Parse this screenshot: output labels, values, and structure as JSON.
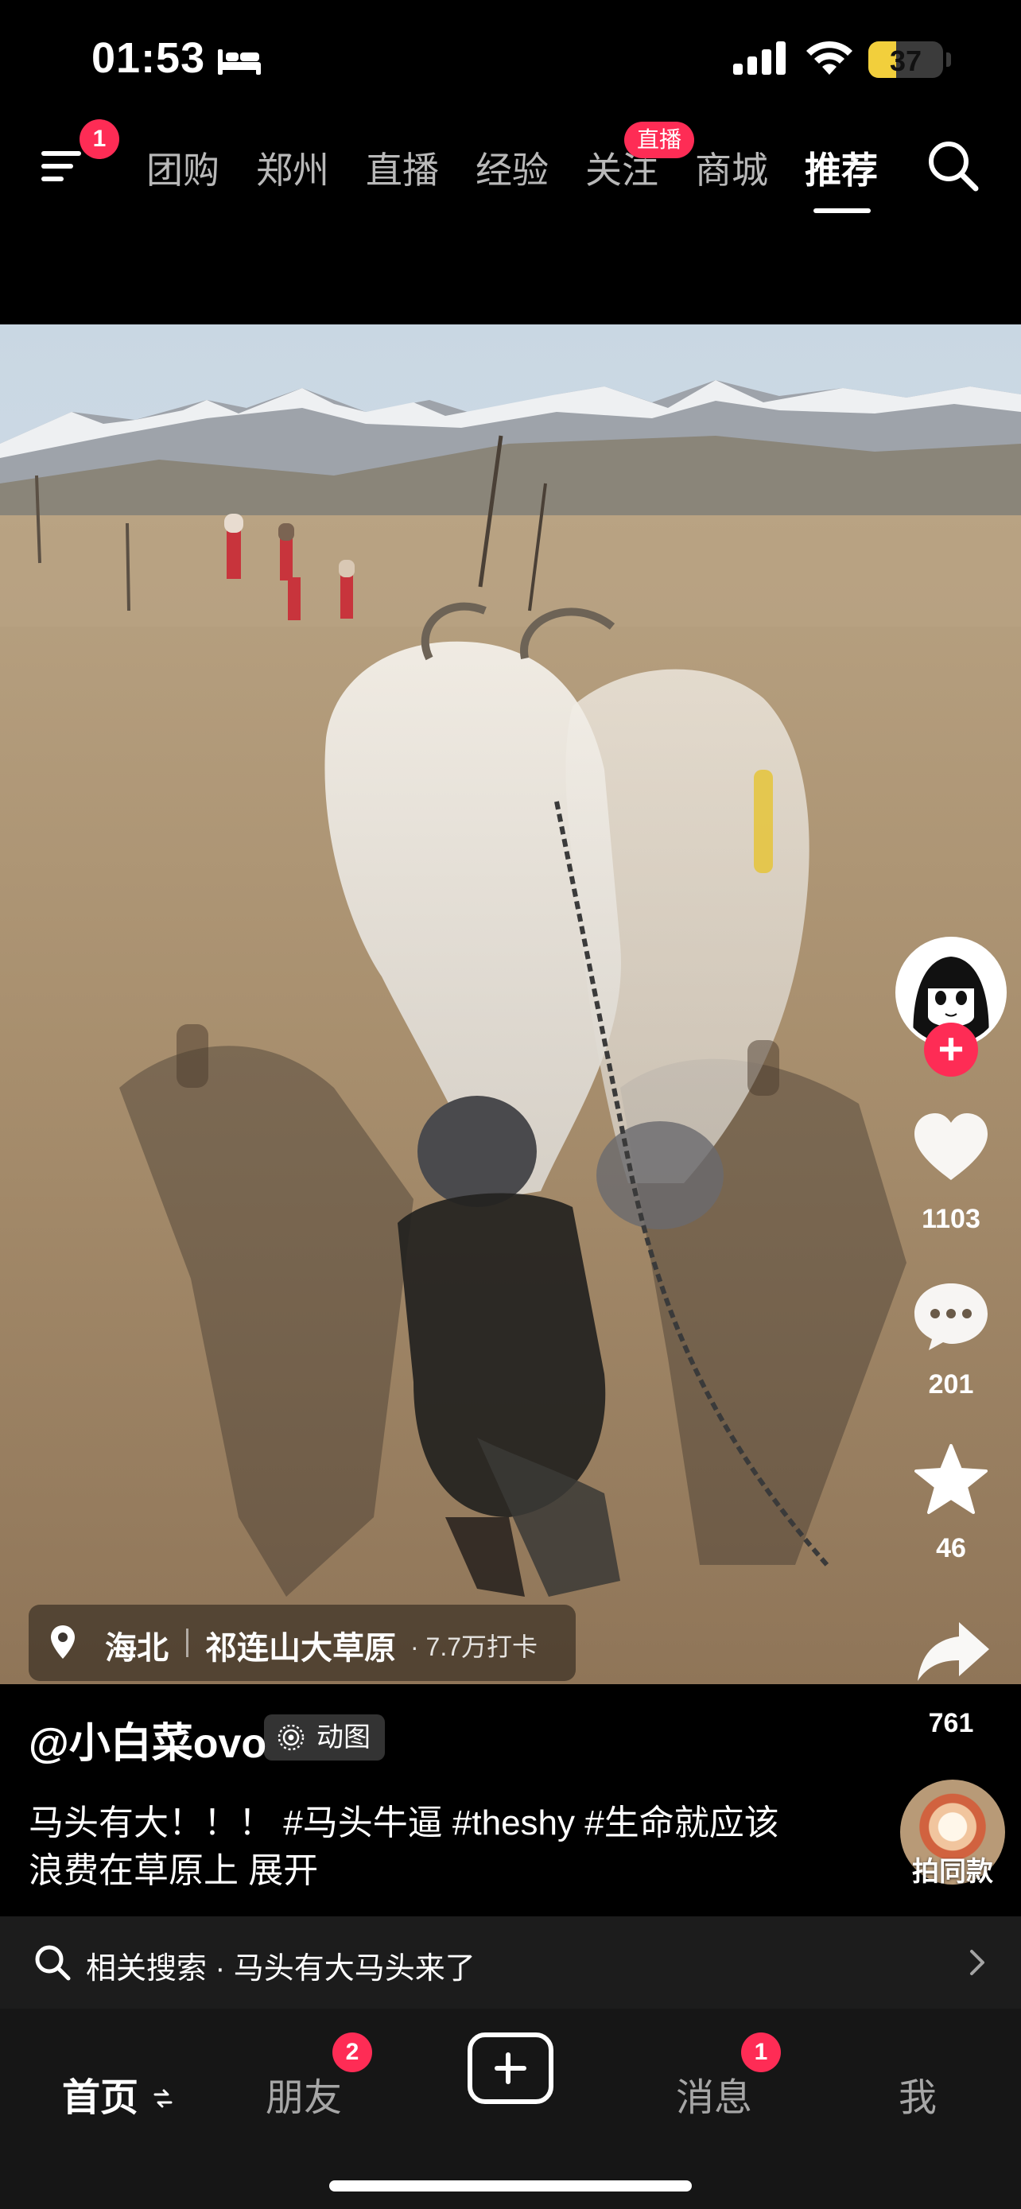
{
  "status_bar": {
    "time": "01:53",
    "battery": "37",
    "battery_level": 0.37
  },
  "top_nav": {
    "menu_badge": "1",
    "tabs": [
      {
        "label": "团购"
      },
      {
        "label": "郑州"
      },
      {
        "label": "直播"
      },
      {
        "label": "经验"
      },
      {
        "label": "关注"
      },
      {
        "label": "商城"
      },
      {
        "label": "推荐"
      }
    ],
    "active_tab": "推荐",
    "live_badge": "直播"
  },
  "video": {
    "location": {
      "city": "海北",
      "place": "祁连山大草原",
      "checkins": "· 7.7万打卡"
    }
  },
  "actions": {
    "likes": "1103",
    "comments": "201",
    "favorites": "46",
    "shares": "761"
  },
  "caption": {
    "author": "@小白菜ovo",
    "type_badge": "动图",
    "line1": "马头有大！！！ #马头牛逼 #theshy #生命就应该",
    "line2": "浪费在草原上  展开",
    "same_style": "拍同款"
  },
  "related_search": {
    "text": "相关搜索 · 马头有大马头来了"
  },
  "bottom_tabs": {
    "home": "首页",
    "friends": "朋友",
    "friends_badge": "2",
    "messages": "消息",
    "messages_badge": "1",
    "me": "我"
  },
  "colors": {
    "accent": "#fe2c55",
    "background": "#000000",
    "battery": "#f2cf3c"
  }
}
